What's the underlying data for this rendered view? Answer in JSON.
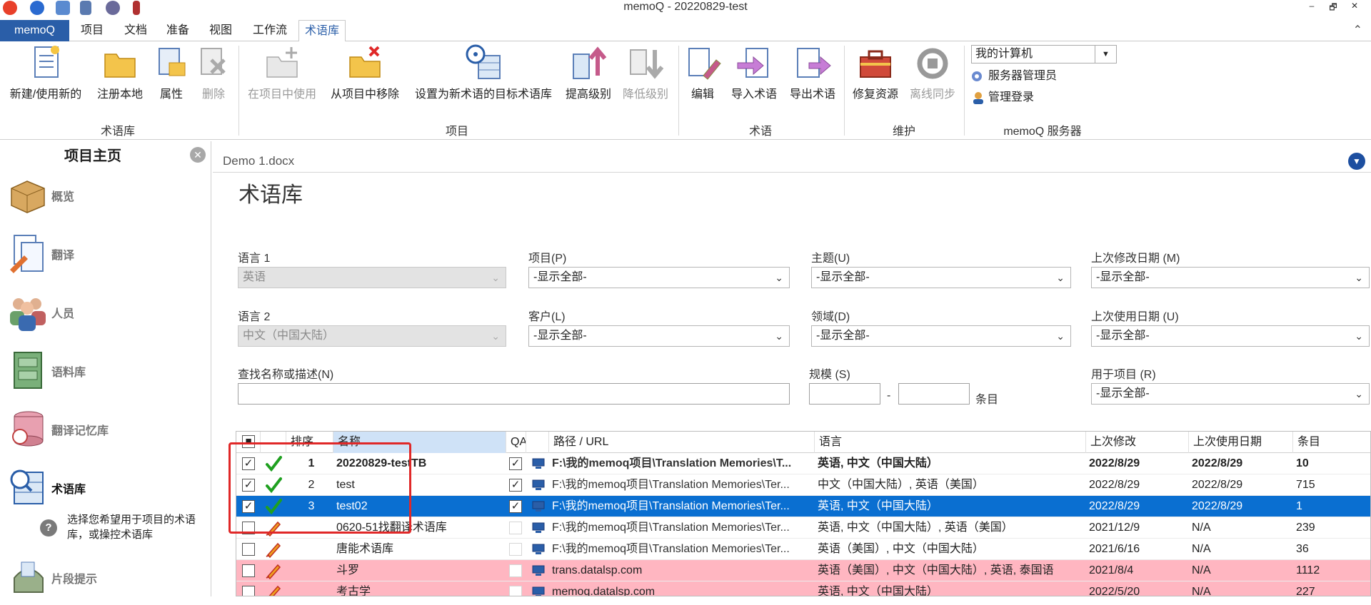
{
  "window": {
    "title": "memoQ - 20220829-test",
    "controls": [
      "–",
      "🗗",
      "✕"
    ]
  },
  "tabs": {
    "file": "memoQ",
    "items": [
      "项目",
      "文档",
      "准备",
      "视图",
      "工作流",
      "术语库"
    ],
    "active": "术语库"
  },
  "ribbon": {
    "buttons": {
      "new_use": "新建/使用新的",
      "register_local": "注册本地",
      "properties": "属性",
      "delete": "删除",
      "use_in_project": "在项目中使用",
      "remove_from_project": "从项目中移除",
      "set_target": "设置为新术语的目标术语库",
      "raise_rank": "提高级别",
      "lower_rank": "降低级别",
      "edit": "编辑",
      "import_terms": "导入术语",
      "export_terms": "导出术语",
      "repair": "修复资源",
      "offline_sync": "离线同步"
    },
    "groups": {
      "termbase": "术语库",
      "project": "项目",
      "terms": "术语",
      "maintenance": "维护",
      "server": "memoQ 服务器"
    },
    "server": {
      "selected": "我的计算机",
      "admin": "服务器管理员",
      "login": "管理登录"
    }
  },
  "left_panel": {
    "title": "项目主页",
    "close": "✕",
    "items": [
      "概览",
      "翻译",
      "人员",
      "语料库",
      "翻译记忆库",
      "术语库",
      "片段提示"
    ],
    "active": "术语库",
    "help": "?",
    "description": "选择您希望用于项目的术语库，或操控术语库"
  },
  "document_tab": {
    "label": "Demo 1.docx",
    "dropdown": "▼"
  },
  "page": {
    "heading": "术语库"
  },
  "filters": {
    "lang1_label": "语言 1",
    "lang1_value": "英语",
    "lang2_label": "语言 2",
    "lang2_value": "中文（中国大陆）",
    "project_label": "项目(P)",
    "project_value": "-显示全部-",
    "client_label": "客户(L)",
    "client_value": "-显示全部-",
    "subject_label": "主题(U)",
    "subject_value": "-显示全部-",
    "domain_label": "领域(D)",
    "domain_value": "-显示全部-",
    "last_modified_label": "上次修改日期 (M)",
    "last_modified_value": "-显示全部-",
    "last_used_label": "上次使用日期 (U)",
    "last_used_value": "-显示全部-",
    "search_label": "查找名称或描述(N)",
    "search_value": "",
    "size_label": "规模 (S)",
    "size_from": "",
    "size_dash": "-",
    "size_unit": "条目",
    "used_in_project_label": "用于项目 (R)",
    "used_in_project_value": "-显示全部-"
  },
  "table": {
    "columns": [
      "",
      "",
      "排序",
      "名称",
      "QA",
      "",
      "路径 / URL",
      "语言",
      "上次修改",
      "上次使用日期",
      "条目"
    ],
    "rows": [
      {
        "checked": true,
        "status": "check",
        "rank": "1",
        "name": "20220829-testTB",
        "qa": true,
        "path": "F:\\我的memoq项目\\Translation Memories\\T...",
        "languages": "英语, 中文（中国大陆）",
        "modified": "2022/8/29",
        "used": "2022/8/29",
        "entries": "10",
        "style": "bold"
      },
      {
        "checked": true,
        "status": "check",
        "rank": "2",
        "name": "test",
        "qa": true,
        "path": "F:\\我的memoq项目\\Translation Memories\\Ter...",
        "languages": "中文（中国大陆）, 英语（美国）",
        "modified": "2022/8/29",
        "used": "2022/8/29",
        "entries": "715",
        "style": "normal"
      },
      {
        "checked": true,
        "status": "check",
        "rank": "3",
        "name": "test02",
        "qa": true,
        "path": "F:\\我的memoq项目\\Translation Memories\\Ter...",
        "languages": "英语, 中文（中国大陆）",
        "modified": "2022/8/29",
        "used": "2022/8/29",
        "entries": "1",
        "style": "selected"
      },
      {
        "checked": false,
        "status": "pencil",
        "rank": "",
        "name": "0620-51找翻译术语库",
        "qa": false,
        "path": "F:\\我的memoq项目\\Translation Memories\\Ter...",
        "languages": "英语, 中文（中国大陆）, 英语（美国）",
        "modified": "2021/12/9",
        "used": "N/A",
        "entries": "239",
        "style": "normal"
      },
      {
        "checked": false,
        "status": "pencil",
        "rank": "",
        "name": "唐能术语库",
        "qa": false,
        "path": "F:\\我的memoq项目\\Translation Memories\\Ter...",
        "languages": "英语（美国）, 中文（中国大陆）",
        "modified": "2021/6/16",
        "used": "N/A",
        "entries": "36",
        "style": "normal"
      },
      {
        "checked": false,
        "status": "pencil",
        "rank": "",
        "name": "斗罗",
        "qa": false,
        "path": "trans.datalsp.com",
        "languages": "英语（美国）, 中文（中国大陆）, 英语, 泰国语",
        "modified": "2021/8/4",
        "used": "N/A",
        "entries": "1112",
        "style": "pink"
      },
      {
        "checked": false,
        "status": "pencil",
        "rank": "",
        "name": "考古学",
        "qa": false,
        "path": "memoq.datalsp.com",
        "languages": "英语, 中文（中国大陆）",
        "modified": "2022/5/20",
        "used": "N/A",
        "entries": "227",
        "style": "pink"
      }
    ]
  },
  "colors": {
    "accent": "#2a5ea8",
    "selected_row": "#0a6fd1",
    "pink_row": "#ffb6c1",
    "highlight_box": "#e02828"
  }
}
